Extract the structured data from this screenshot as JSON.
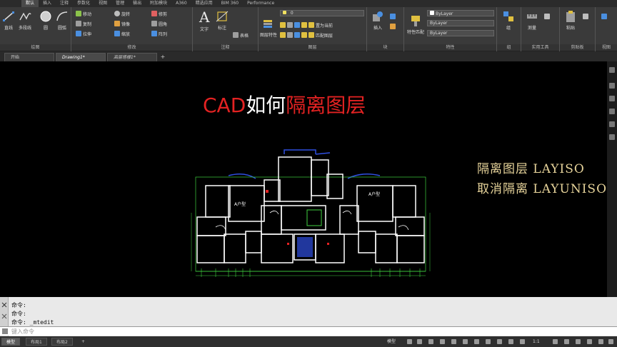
{
  "menu": {
    "tabs": [
      "默认",
      "插入",
      "注释",
      "参数化",
      "视图",
      "管理",
      "输出",
      "附加模块",
      "A360",
      "精选应用",
      "BIM 360",
      "Performance"
    ]
  },
  "ribbon": {
    "draw": {
      "line": "直线",
      "polyline": "多段线",
      "circle": "圆",
      "arc": "圆弧",
      "title": "绘图"
    },
    "modify": {
      "move": "移动",
      "rotate": "旋转",
      "trim": "修剪",
      "copy": "复制",
      "mirror": "镜像",
      "fillet": "圆角",
      "stretch": "拉伸",
      "scale": "缩放",
      "array": "阵列",
      "title": "修改"
    },
    "annotation": {
      "text": "文字",
      "dimension": "标注",
      "table": "表格",
      "title": "注释"
    },
    "layers": {
      "layer_props": "图层特性",
      "layer_current": "0",
      "set_current": "置为当前",
      "match_layer": "匹配图层",
      "title": "图层"
    },
    "block": {
      "insert": "插入",
      "title": "块"
    },
    "properties": {
      "match": "特性匹配",
      "bylayer1": "ByLayer",
      "bylayer2": "ByLayer",
      "bylayer3": "ByLayer",
      "title": "特性"
    },
    "groups": {
      "group": "组",
      "title": "组"
    },
    "utilities": {
      "measure": "测量",
      "title": "实用工具"
    },
    "clipboard": {
      "paste": "粘贴",
      "title": "剪贴板"
    },
    "view": {
      "title": "视图"
    }
  },
  "doctabs": [
    "开始",
    "Drawing1*",
    "高层塔楼1*"
  ],
  "canvas": {
    "title_red1": "CAD",
    "title_white": "如何",
    "title_red2": "隔离图层",
    "line1": "隔离图层 LAYISO",
    "line2": "取消隔离 LAYUNISO",
    "room_a1": "A户型",
    "room_a2": "A户型"
  },
  "command": {
    "history": [
      "命令:",
      "命令:",
      "命令: _mtedit"
    ],
    "placeholder": "键入命令"
  },
  "statusbar": {
    "tabs": [
      "模型",
      "布局1",
      "布局2"
    ],
    "model": "模型",
    "scale": "1:1"
  },
  "colors": {
    "title_red": "#e32222",
    "note_yellow": "#e6d39a",
    "wall_white": "#ffffff",
    "dim_green": "#3fd13f",
    "balcony_blue": "#2f4fe0"
  }
}
